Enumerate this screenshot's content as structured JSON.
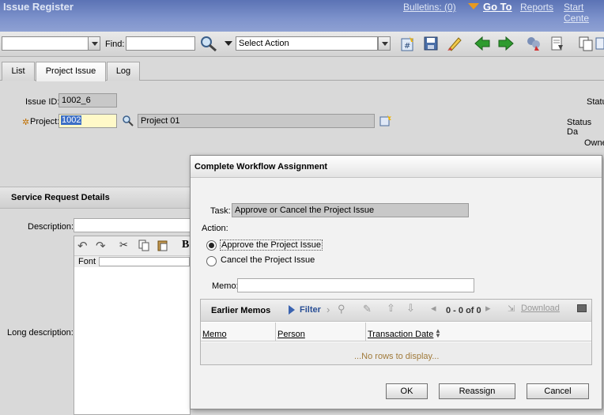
{
  "header": {
    "app_title": "Issue Register",
    "bulletins": "Bulletins: (0)",
    "goto": "Go To",
    "reports": "Reports",
    "start_center": "Start Cente"
  },
  "toolbar": {
    "find_label": "Find:",
    "find_value": "",
    "action_select": "Select Action"
  },
  "tabs": [
    {
      "label": "List"
    },
    {
      "label": "Project Issue"
    },
    {
      "label": "Log"
    }
  ],
  "form": {
    "issue_id_label": "Issue ID:",
    "issue_id_value": "1002_6",
    "project_label": "Project:",
    "project_value": "1002",
    "project_desc": "Project 01",
    "status_label": "Statu",
    "status_date_label": "Status Da",
    "owner_label": "Owne"
  },
  "service_request": {
    "title": "Service Request Details",
    "description_label": "Description:",
    "long_description_label": "Long description:",
    "font_label": "Font",
    "bold_glyph": "B"
  },
  "dialog": {
    "title": "Complete Workflow Assignment",
    "task_label": "Task:",
    "task_value": "Approve or Cancel the Project Issue",
    "action_label": "Action:",
    "options": [
      {
        "label": "Approve the Project Issue",
        "selected": true
      },
      {
        "label": "Cancel the Project Issue",
        "selected": false
      }
    ],
    "memo_label": "Memo:",
    "memo_value": "",
    "earlier_memos": {
      "title": "Earlier Memos",
      "filter": "Filter",
      "paging": "0 - 0 of 0",
      "download": "Download",
      "columns": [
        "Memo",
        "Person",
        "Transaction Date"
      ],
      "empty_text": "...No rows to display..."
    },
    "buttons": {
      "ok": "OK",
      "reassign": "Reassign",
      "cancel": "Cancel"
    }
  },
  "colors": {
    "title_bar": "#6f86c4",
    "accent_arrow": "#e89a1f",
    "nav_arrow_green": "#2e9b2e"
  }
}
